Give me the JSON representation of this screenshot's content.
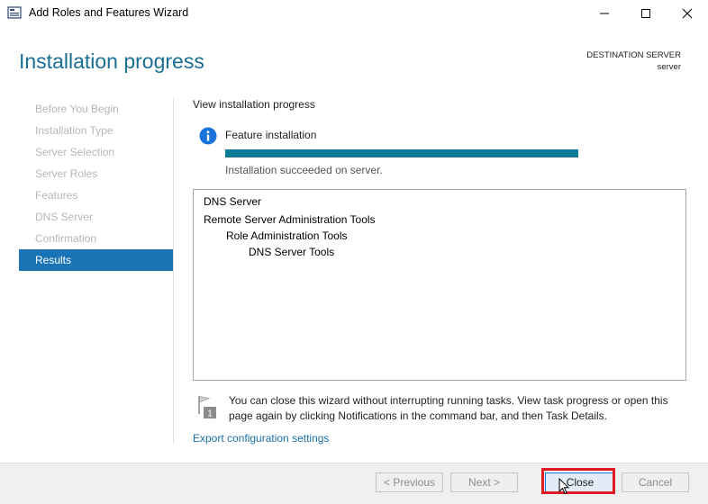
{
  "window": {
    "title": "Add Roles and Features Wizard"
  },
  "header": {
    "page_title": "Installation progress",
    "destination_label": "DESTINATION SERVER",
    "destination_value": "server"
  },
  "nav": {
    "items": [
      {
        "label": "Before You Begin",
        "active": false
      },
      {
        "label": "Installation Type",
        "active": false
      },
      {
        "label": "Server Selection",
        "active": false
      },
      {
        "label": "Server Roles",
        "active": false
      },
      {
        "label": "Features",
        "active": false
      },
      {
        "label": "DNS Server",
        "active": false
      },
      {
        "label": "Confirmation",
        "active": false
      },
      {
        "label": "Results",
        "active": true
      }
    ]
  },
  "main": {
    "section_heading": "View installation progress",
    "feature_label": "Feature installation",
    "progress_fraction": 1.0,
    "progress_status": "Installation succeeded on server.",
    "results": [
      {
        "text": "DNS Server",
        "level": 0
      },
      {
        "text": "Remote Server Administration Tools",
        "level": 0
      },
      {
        "text": "Role Administration Tools",
        "level": 1
      },
      {
        "text": "DNS Server Tools",
        "level": 2
      }
    ],
    "note": "You can close this wizard without interrupting running tasks. View task progress or open this page again by clicking Notifications in the command bar, and then Task Details.",
    "export_link": "Export configuration settings"
  },
  "footer": {
    "previous_label": "< Previous",
    "next_label": "Next >",
    "close_label": "Close",
    "cancel_label": "Cancel"
  },
  "colors": {
    "accent_title": "#1a6e95",
    "nav_active": "#1a73b5",
    "progress": "#0b7a96",
    "highlight": "#e01b24"
  }
}
